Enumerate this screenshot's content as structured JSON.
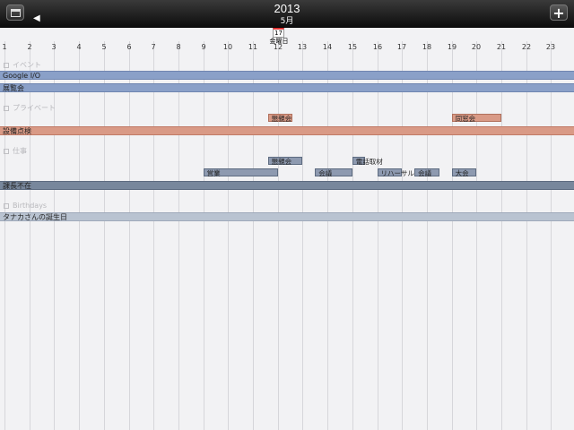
{
  "header": {
    "year": "2013",
    "month": "5月",
    "back_arrow": "◀",
    "add_label": "+"
  },
  "today": {
    "day": "17",
    "weekday": "金曜日"
  },
  "hours": [
    "1",
    "2",
    "3",
    "4",
    "5",
    "6",
    "7",
    "8",
    "9",
    "10",
    "11",
    "12",
    "13",
    "14",
    "15",
    "16",
    "17",
    "18",
    "19",
    "20",
    "21",
    "22",
    "23"
  ],
  "groups": {
    "events": {
      "header": "イベント",
      "allday": [
        "Google I/O",
        "展覧会"
      ]
    },
    "private": {
      "header": "プライベート",
      "timed": [
        {
          "label": "懇親会",
          "start": 11.6,
          "end": 12.6
        },
        {
          "label": "同窓会",
          "start": 19.0,
          "end": 21.0
        }
      ],
      "allday": [
        "設備点検"
      ]
    },
    "work": {
      "header": "仕事",
      "timed": [
        {
          "label": "懇親会",
          "start": 11.6,
          "end": 13.0,
          "row": 0
        },
        {
          "label": "電話取材",
          "start": 15.0,
          "end": 15.5,
          "row": 0
        },
        {
          "label": "営業",
          "start": 9.0,
          "end": 12.0,
          "row": 1
        },
        {
          "label": "会議",
          "start": 13.5,
          "end": 15.0,
          "row": 1
        },
        {
          "label": "リハーサル",
          "start": 16.0,
          "end": 17.0,
          "row": 1
        },
        {
          "label": "会議",
          "start": 17.5,
          "end": 18.5,
          "row": 1
        },
        {
          "label": "大会",
          "start": 19.0,
          "end": 20.0,
          "row": 1
        }
      ],
      "allday": [
        "課長不在"
      ]
    },
    "birthdays": {
      "header": "Birthdays",
      "allday": [
        "タナカさんの誕生日"
      ]
    }
  },
  "colors": {
    "topbar": "#1a1a1a",
    "event_blue": "#8aa0c8",
    "event_salmon": "#d99a86",
    "event_slate": "#78879c",
    "birthday": "#b9c3d1",
    "today_accent": "#dd3333"
  }
}
